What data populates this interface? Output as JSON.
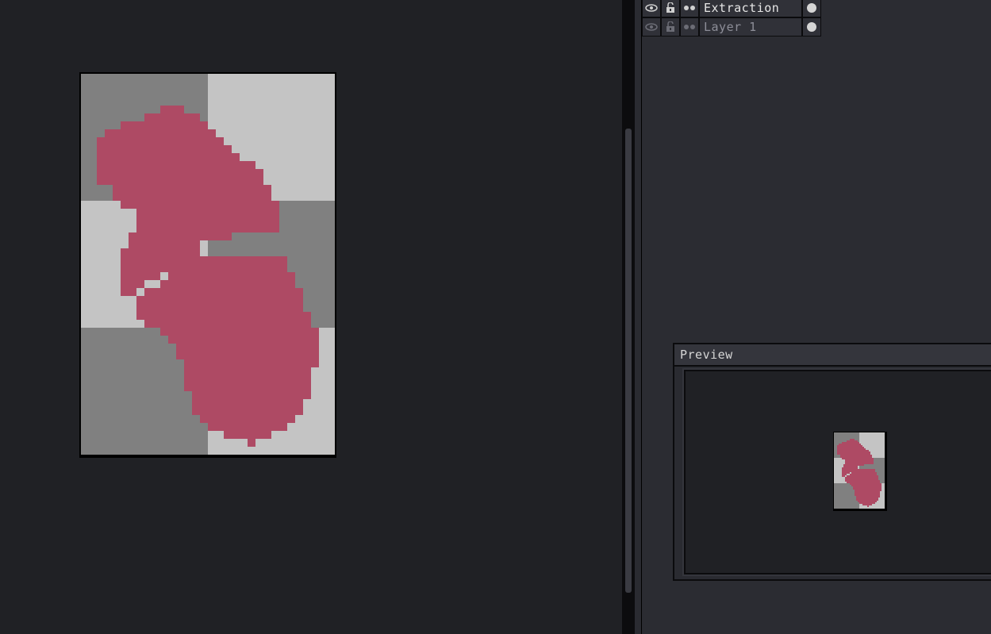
{
  "layers": [
    {
      "name": "Extraction",
      "visible": true,
      "locked": false,
      "active": true,
      "eye_icon": "eye-icon",
      "lock_icon": "unlock-icon",
      "continuous_icon": "link-dots-icon"
    },
    {
      "name": "Layer 1",
      "visible": true,
      "locked": false,
      "active": false,
      "eye_icon": "eye-icon",
      "lock_icon": "unlock-icon",
      "continuous_icon": "link-dots-icon"
    }
  ],
  "preview": {
    "title": "Preview"
  },
  "colors": {
    "checker_dark": "#808080",
    "checker_light": "#c4c4c4",
    "sprite": "#ae4a64",
    "background": "#202125",
    "panel": "#2b2c32"
  }
}
